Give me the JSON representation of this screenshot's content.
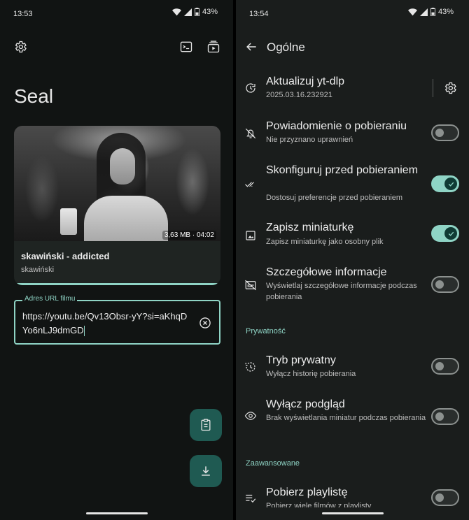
{
  "left": {
    "status": {
      "time": "13:53",
      "battery": "43%"
    },
    "toolbar": {
      "settings_icon": "gear-icon",
      "terminal_icon": "terminal-icon",
      "queue_icon": "video-queue-icon"
    },
    "app_title": "Seal",
    "video_card": {
      "meta": "3,63 MB · 04:02",
      "title": "skawiński - addicted",
      "channel": "skawiński",
      "progress": 1.0
    },
    "url_field": {
      "label": "Adres URL filmu",
      "value": "https://youtu.be/Qv13Obsr-yY?si=aKhqDYo6nLJ9dmGD"
    },
    "fabs": {
      "paste_icon": "clipboard-icon",
      "download_icon": "download-icon"
    }
  },
  "right": {
    "status": {
      "time": "13:54",
      "battery": "43%"
    },
    "header": {
      "title": "Ogólne"
    },
    "items": [
      {
        "title": "Aktualizuj yt-dlp",
        "subtitle": "2025.03.16.232921",
        "icon": "update-icon"
      },
      {
        "title": "Powiadomienie o pobieraniu",
        "subtitle": "Nie przyznano uprawnień",
        "icon": "notifications-off-icon",
        "enabled": false
      },
      {
        "title": "Skonfiguruj przed pobieraniem",
        "subtitle": "Dostosuj preferencje przed pobieraniem",
        "icon": "done-all-icon",
        "enabled": true
      },
      {
        "title": "Zapisz miniaturkę",
        "subtitle": "Zapisz miniaturkę jako osobny plik",
        "icon": "image-icon",
        "enabled": true
      },
      {
        "title": "Szczegółowe informacje",
        "subtitle": "Wyświetlaj szczegółowe informacje podczas pobierania",
        "icon": "subtitles-off-icon",
        "enabled": false
      },
      {
        "title": "Tryb prywatny",
        "subtitle": "Wyłącz historię pobierania",
        "icon": "history-toggle-icon",
        "enabled": false
      },
      {
        "title": "Wyłącz podgląd",
        "subtitle": "Brak wyświetlania miniatur podczas pobierania",
        "icon": "eye-icon",
        "enabled": false
      },
      {
        "title": "Pobierz playlistę",
        "subtitle": "Pobierz wiele filmów z playlisty",
        "icon": "playlist-icon",
        "enabled": false
      }
    ],
    "sections": {
      "privacy": "Prywatność",
      "advanced": "Zaawansowane"
    }
  }
}
